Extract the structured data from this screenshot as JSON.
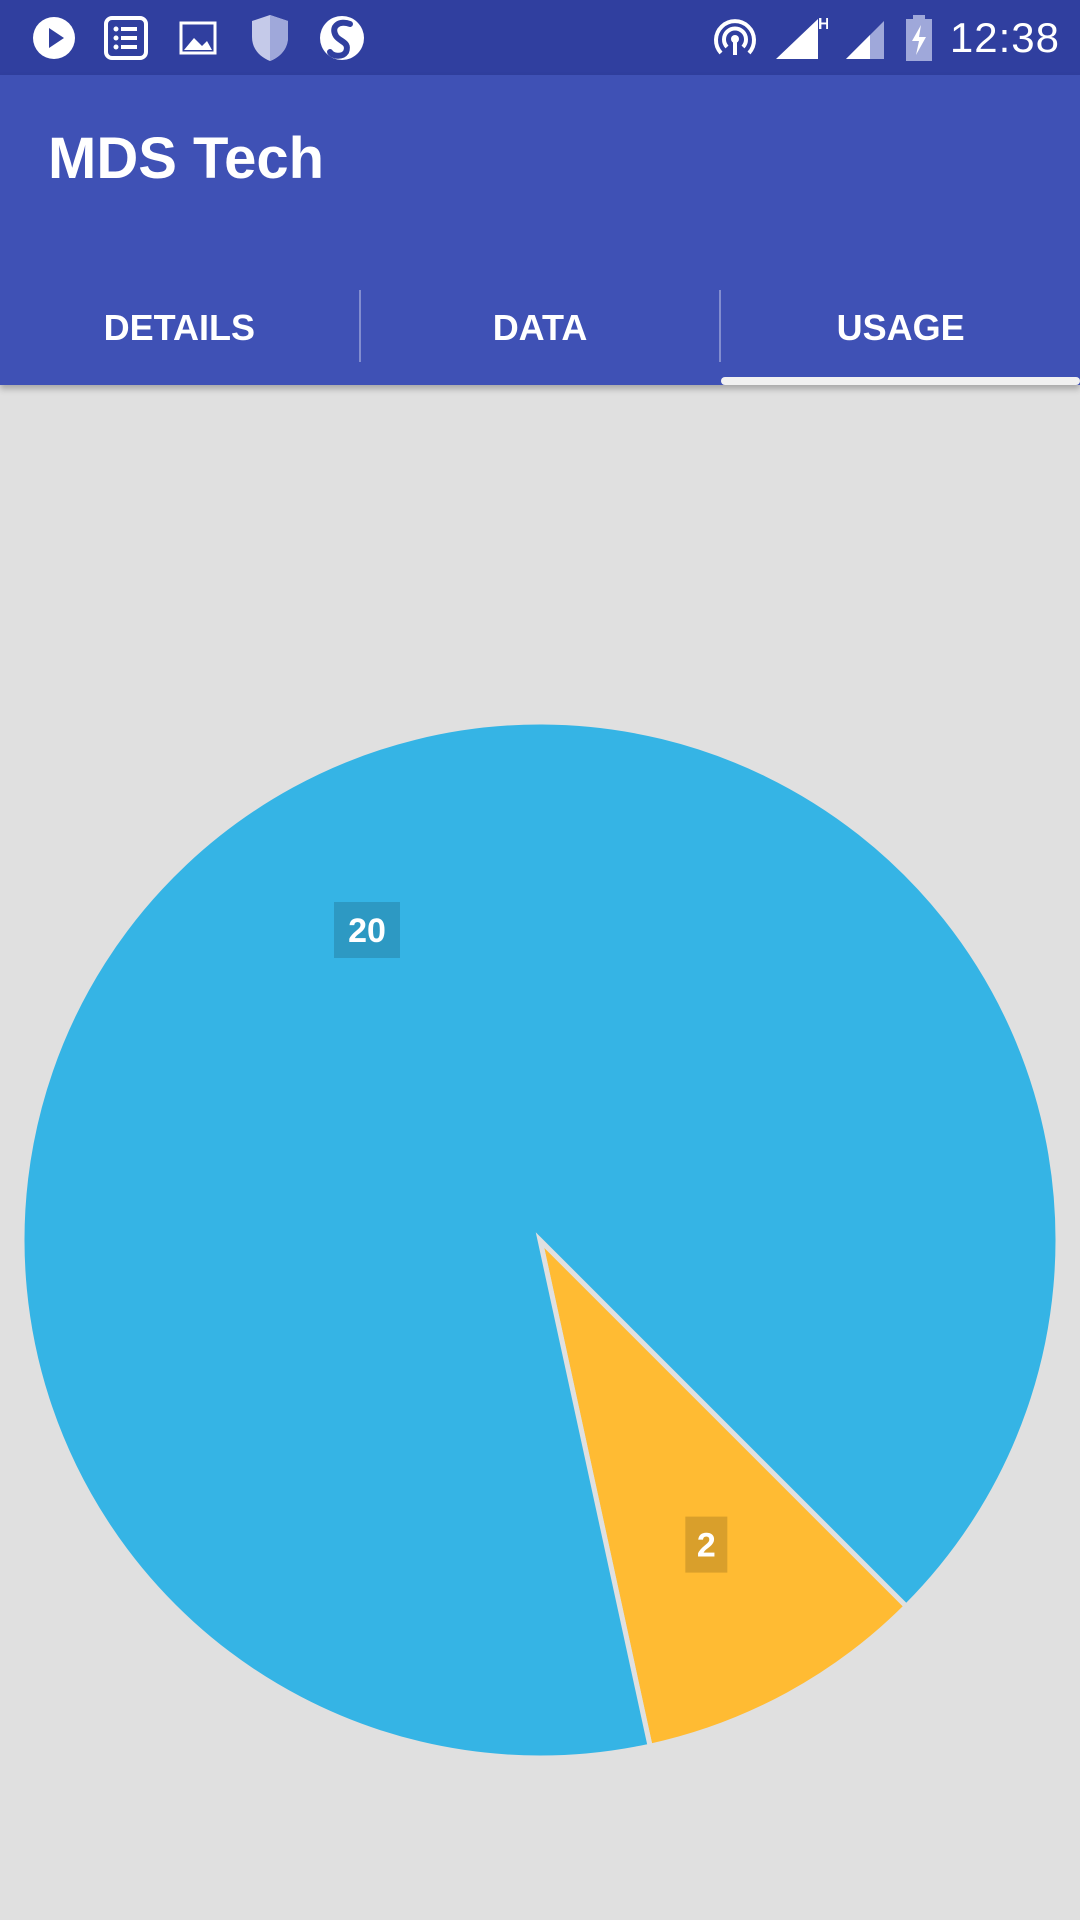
{
  "status_bar": {
    "left_icons": [
      "play-store-icon",
      "task-list-icon",
      "gallery-icon",
      "shield-icon",
      "s-app-icon"
    ],
    "right_icons": [
      "hotspot-icon",
      "signal-h-icon",
      "signal-icon",
      "battery-charging-icon"
    ],
    "time": "12:38"
  },
  "app_bar": {
    "title": "MDS Tech",
    "color": "#3f51b5",
    "status_color": "#303f9f"
  },
  "tabs": [
    {
      "label": "DETAILS",
      "selected": false
    },
    {
      "label": "DATA",
      "selected": false
    },
    {
      "label": "USAGE",
      "selected": true
    }
  ],
  "chart_data": {
    "type": "pie",
    "slices": [
      {
        "value": 20,
        "label": "20",
        "color": "#35b4e5"
      },
      {
        "value": 2,
        "label": "2",
        "color": "#ffbb33"
      }
    ],
    "title": "",
    "legend": false
  }
}
